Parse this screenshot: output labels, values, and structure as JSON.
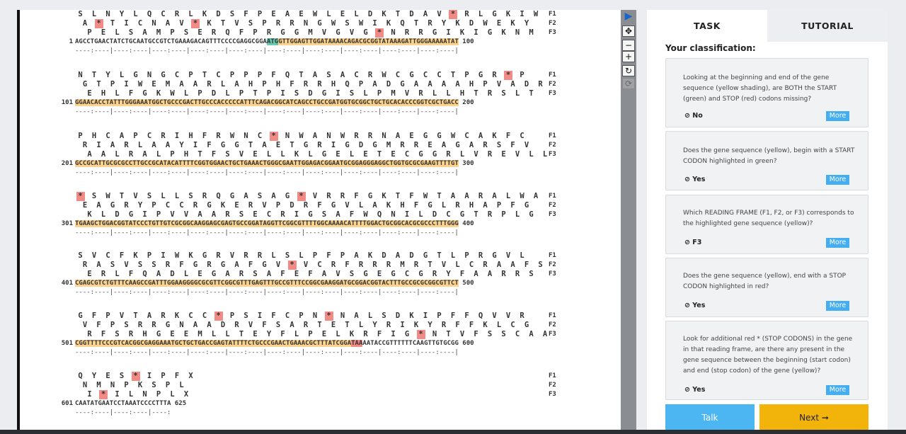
{
  "tabs": {
    "task": "TASK",
    "tutorial": "TUTORIAL"
  },
  "classification_title": "Your classification:",
  "questions": [
    {
      "text": "Looking at the beginning and end of the gene sequence (yellow shading), are BOTH the START (green) and STOP (red) codons missing?",
      "answer": "No",
      "more": "More"
    },
    {
      "text": "Does the gene sequence (yellow), begin with a START CODON highlighted in green?",
      "answer": "Yes",
      "more": "More"
    },
    {
      "text": "Which READING FRAME (F1, F2, or F3) corresponds to the highlighted gene sequence (yellow)?",
      "answer": "F3",
      "more": "More"
    },
    {
      "text": "Does the gene sequence (yellow), end with a STOP CODON highlighted in red?",
      "answer": "Yes",
      "more": "More"
    },
    {
      "text": "Look for additional red * (STOP CODONS) in the gene in that reading frame, are there any present in the gene sequence between the beginning (start codon) and end (stop codon) of the gene (yellow)?",
      "answer": "Yes",
      "more": "More"
    }
  ],
  "buttons": {
    "talk": "Talk",
    "next": "Next ➞"
  },
  "toolbar_icons": [
    "pointer-icon",
    "move-icon",
    "zoom-out-icon",
    "zoom-in-icon",
    "reset-icon",
    "refresh-icon"
  ],
  "frame_labels": [
    "F1",
    "F2",
    "F3"
  ],
  "ruler": "----:----|----:----|----:----|----:----|----:----|----:----|----:----|----:----|----:----|----:----|",
  "blocks": [
    {
      "start": "1",
      "end": "100",
      "f1": "S L N Y L Q C R L K D S F P E A E W L E L D K T D A V * R L G K I W",
      "f2": "A * T I C N A V * K T V S P R R N G W S W I K Q T R Y K D W E K Y",
      "f3": "P E L S A M P S E R Q F P R G G M V G V G * N R R G I K I G K N M",
      "dna_pre": "AGCCTGAACTATCTGCAATGCCGTCTGAAAGACAGTTTCCCCGAGGCGGA",
      "dna_green": "ATG",
      "dna_yellow": "GTTGGAGTTGGATAAAACAGACGCGGTATAAAGATTGGGAAAAATAT",
      "dna_red": "",
      "dna_post": ""
    },
    {
      "start": "101",
      "end": "200",
      "f1": "N T Y L G N G C P T C P P P F Q T A S A C R W C G C C T P G R * P",
      "f2": "G T P I W E M A A R L A H P H F R R H Q P A D G A A A A H P V A D R",
      "f3": "E H L F G K W L P D L P T P I S D G I S L P M V R L L H T R S L T",
      "dna_pre": "",
      "dna_green": "",
      "dna_yellow": "GGAACACCTATTTGGGAAATGGCTGCCCGACTTGCCCACCCCCATTTCAGACGGCATCAGCCTGCCGATGGTGCGGCTGCTGCACACCCGGTCGCTGACC",
      "dna_red": "",
      "dna_post": ""
    },
    {
      "start": "201",
      "end": "300",
      "f1": "P H C A P C R I H F R W N C * N W A N W R R N A E G G W C A K F C",
      "f2": "R I A R L A A Y I F G G T A E T G R I G D G M R R E A G A R S F V",
      "f3": "A A L R A L P H T F S V E L L K L G E L E T E C G G R L V R E V L L",
      "dna_pre": "",
      "dna_green": "",
      "dna_yellow": "GCCGCATTGCGCGCCTTGCCGCATACATTTTCGGTGGAACTGCTGAAACTGGGCGAATTGGAGACGGAATGCGGAGGGAGGCTGGTGCGCGAAGTTTTGT",
      "dna_red": "",
      "dna_post": ""
    },
    {
      "start": "301",
      "end": "400",
      "f1": "* S W T V S L L S R Q G A S A G * V R R F G K T F W T A A R A L W A",
      "f2": "E A G R Y P C C R G K E R V P D R F G V L A K H F G L R H A P F G",
      "f3": "K L D G I P V V A A R S E C R I G S A F W Q N I L D C G T R P L G",
      "dna_pre": "",
      "dna_green": "",
      "dna_yellow": "TGAAGCTGGACGGTATCCCTGTTGTCGCGGCAAGGAGCGAGTGCCGGATAGGTTCGGCGTTTTGGCAAAACATTTTGGACTGCGGCACGCGCCCTTTGGG",
      "dna_red": "",
      "dna_post": ""
    },
    {
      "start": "401",
      "end": "500",
      "f1": "S V C F K P I W K G R V R R L S L P F P A K D A D G T L P R G V L",
      "f2": "R A S V S S R F G R G A F G V * V C R F R R R M R T V L C R A A F S",
      "f3": "E R L F Q A D L E G A R S A F E F A V S G E G C G R Y F A A R R S",
      "dna_pre": "",
      "dna_green": "",
      "dna_yellow": "CGAGCGTCTGTTTCAAGCCGATTTGGAAGGGGCGCGTTCGGCGTTTGAGTTTGCCGTTTCCGGCGAAGGATGCGGACGGTACTTTGCCGCGCGGCGTTCT",
      "dna_red": "",
      "dna_post": ""
    },
    {
      "start": "501",
      "end": "600",
      "f1": "G F P V T A R K C C * P S I F C P N * N A L S D K I P F F Q V V R",
      "f2": "V F P S R R G N A A D R V F S A R T E T L Y R I K Y R F F K L C G",
      "f3": "R F S R H G E E M L L T E Y F L P E L K R F I G * N T V F S S C A A",
      "dna_pre": "",
      "dna_green": "",
      "dna_yellow": "CGGTTTTCCCGTCACGGCGAGGAAATGCTGCTGACCGAGTATTTTCTGCCCGAACTGAAACGCTTTATCGGA",
      "dna_red": "TAA",
      "dna_post": "AATACCGTTTTTTCAAGTTGTGCGG"
    },
    {
      "start": "601",
      "end": "625",
      "f1": "Q Y E S * I P F X",
      "f2": "N M N P K S P L",
      "f3": "I * I L N P L X",
      "dna_pre": "CAATATGAATCCTAAATCCCCTTTA",
      "dna_green": "",
      "dna_yellow": "",
      "dna_red": "",
      "dna_post": "",
      "ruler": "----:----|----:----|----:"
    }
  ]
}
